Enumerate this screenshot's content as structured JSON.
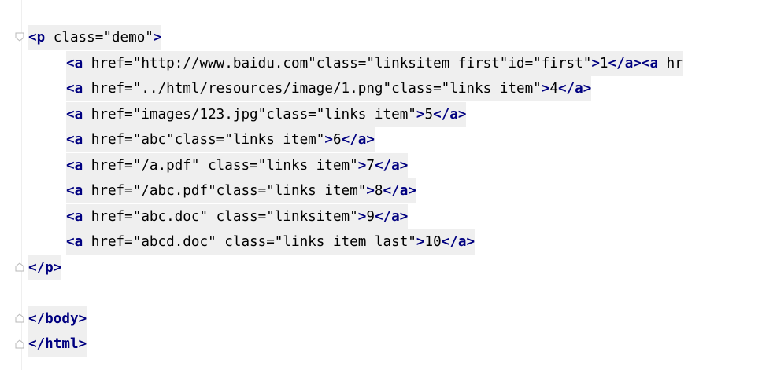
{
  "editor": {
    "lines": [
      {
        "text": "<p class=\"demo\">"
      },
      {
        "text": "<a href=\"http://www.baidu.com\"class=\"linksitem first\"id=\"first\">1</a><a hr"
      },
      {
        "text": "<a href=\"../html/resources/image/1.png\"class=\"links item\">4</a>"
      },
      {
        "text": "<a href=\"images/123.jpg\"class=\"links item\">5</a>"
      },
      {
        "text": "<a href=\"abc\"class=\"links item\">6</a>"
      },
      {
        "text": "<a href=\"/a.pdf\" class=\"links item\">7</a>"
      },
      {
        "text": "<a href=\"/abc.pdf\"class=\"links item\">8</a>"
      },
      {
        "text": "<a href=\"abc.doc\" class=\"linksitem\">9</a>"
      },
      {
        "text": "<a href=\"abcd.doc\" class=\"links item last\">10</a>"
      },
      {
        "text": "</p>"
      },
      {
        "text": ""
      },
      {
        "text": "</body>"
      },
      {
        "text": "</html>"
      }
    ]
  },
  "gutter": {
    "fold_markers": [
      "fold-open-icon",
      "fold-close-icon",
      "fold-close-icon",
      "fold-close-icon"
    ]
  },
  "colors": {
    "tag": "#000080",
    "attribute": "#0000ff",
    "string": "#008000",
    "line_highlight": "#efefef",
    "identifier_highlight": "#f8efc0"
  }
}
